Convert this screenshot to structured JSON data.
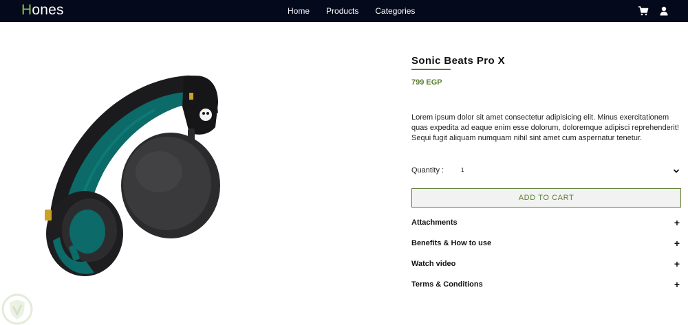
{
  "brand": {
    "first_letter": "H",
    "rest": "ones"
  },
  "nav": {
    "items": [
      "Home",
      "Products",
      "Categories"
    ]
  },
  "icons": {
    "cart": "cart-icon",
    "user": "user-icon"
  },
  "product": {
    "title": "Sonic Beats Pro X",
    "price": "799 EGP",
    "description": "Lorem ipsum dolor sit amet consectetur adipisicing elit. Minus exercitationem quas expedita ad eaque enim esse dolorum, doloremque adipisci reprehenderit! Sequi fugit aliquam numquam nihil sint amet cum aspernatur tenetur.",
    "quantity_label": "Quantity :",
    "quantity_value": "1",
    "add_to_cart_label": "ADD TO CART"
  },
  "accordion": [
    {
      "label": "Attachments"
    },
    {
      "label": "Benefits & How to use"
    },
    {
      "label": "Watch video"
    },
    {
      "label": "Terms & Conditions"
    }
  ],
  "colors": {
    "nav_bg": "#040a1c",
    "accent": "#5b7d2e",
    "brand_accent": "#8bc34a"
  }
}
